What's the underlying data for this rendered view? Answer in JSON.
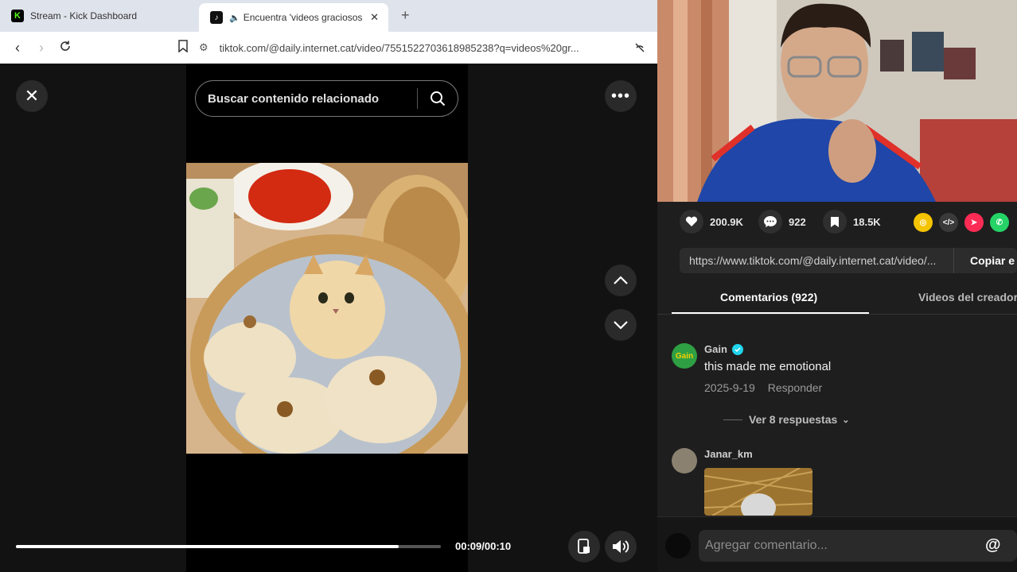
{
  "browser": {
    "tabs": [
      {
        "favicon": "kick-logo-icon",
        "title": "Stream - Kick Dashboard"
      },
      {
        "favicon": "tiktok-logo-icon",
        "title": "Encuentra 'videos graciosos' en"
      }
    ],
    "url": "tiktok.com/@daily.internet.cat/video/7551522703618985238?q=videos%20gr..."
  },
  "player": {
    "search_placeholder": "Buscar contenido relacionado",
    "time": "00:09/00:10",
    "progress": 0.9
  },
  "stats": {
    "likes": "200.9K",
    "comments": "922",
    "saves": "18.5K"
  },
  "share": {
    "link": "https://www.tiktok.com/@daily.internet.cat/video/...",
    "copy_label": "Copiar e"
  },
  "panel_tabs": {
    "comments": "Comentarios (922)",
    "creator_videos": "Videos del creador"
  },
  "comments": [
    {
      "user": "Gain",
      "verified": true,
      "text": "this made me emotional",
      "date": "2025-9-19",
      "reply_label": "Responder",
      "replies_label": "Ver 8 respuestas"
    },
    {
      "user": "Janar_km"
    }
  ],
  "comment_input": {
    "placeholder": "Agregar comentario..."
  },
  "colors": {
    "kick_green": "#53fc18",
    "save_red": "#fe2c55",
    "whatsapp_green": "#25d366",
    "coin_yellow": "#f5c400"
  }
}
